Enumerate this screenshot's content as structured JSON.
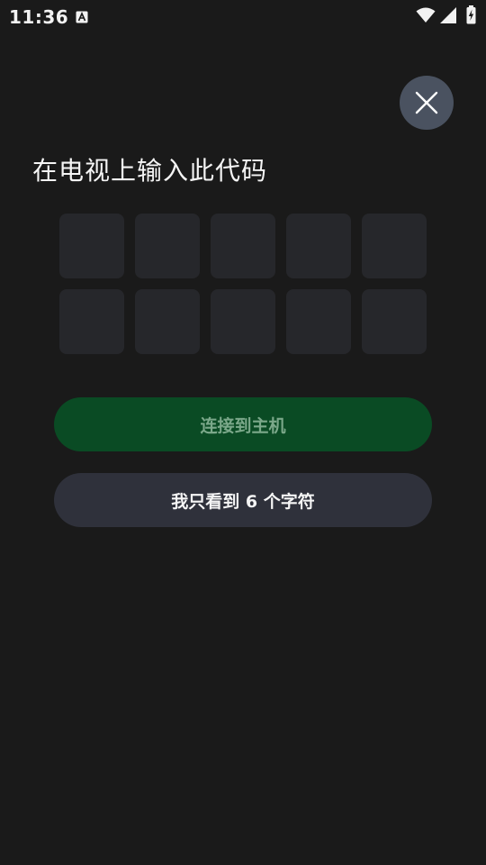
{
  "status_bar": {
    "time": "11:36",
    "notification_icon": "a-letter-icon",
    "icons": [
      "wifi-icon",
      "signal-icon",
      "battery-charging-icon"
    ]
  },
  "close_button": {
    "icon": "close-icon"
  },
  "title": "在电视上输入此代码",
  "code_boxes": {
    "rows": 2,
    "columns": 5,
    "values": [
      "",
      "",
      "",
      "",
      "",
      "",
      "",
      "",
      "",
      ""
    ]
  },
  "connect_button": {
    "label": "连接到主机",
    "enabled": false
  },
  "six_chars_button": {
    "label": "我只看到 6 个字符"
  },
  "colors": {
    "background": "#1a1a1a",
    "close_button_bg": "#4a5260",
    "code_box_bg": "#26272b",
    "connect_button_bg": "#0a4b24",
    "connect_button_text": "#7ba88a",
    "secondary_button_bg": "#2f313b"
  }
}
